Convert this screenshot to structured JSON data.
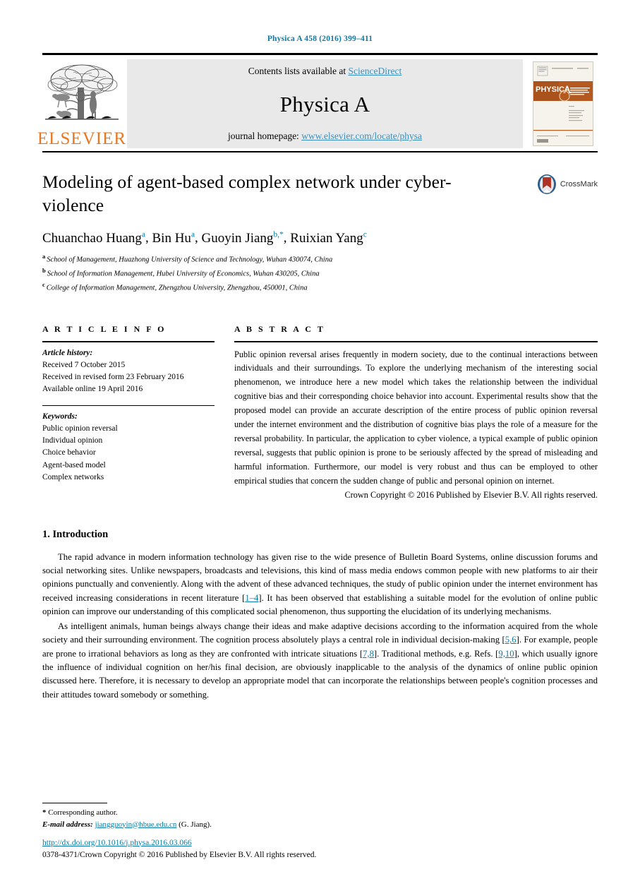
{
  "running_head": "Physica A 458 (2016) 399–411",
  "masthead": {
    "publisher_name": "ELSEVIER",
    "contents_prefix": "Contents lists available at ",
    "contents_link": "ScienceDirect",
    "journal_title": "Physica A",
    "homepage_prefix": "journal homepage: ",
    "homepage_link": "www.elsevier.com/locate/physa",
    "cover_title": "PHYSICA",
    "cover_letter": "A",
    "cover_subtitle": "STATISTICAL MECHANICS AND ITS APPLICATIONS"
  },
  "article": {
    "title": "Modeling of agent-based complex network under cyber-violence",
    "crossmark_label": "CrossMark",
    "authors": [
      {
        "name": "Chuanchao Huang",
        "marks": "a",
        "sep": ", "
      },
      {
        "name": "Bin Hu",
        "marks": "a",
        "sep": ", "
      },
      {
        "name": "Guoyin Jiang",
        "marks": "b,*",
        "sep": ", "
      },
      {
        "name": "Ruixian Yang",
        "marks": "c",
        "sep": ""
      }
    ],
    "affiliations": [
      {
        "mark": "a",
        "text": "School of Management, Huazhong University of Science and Technology, Wuhan 430074, China"
      },
      {
        "mark": "b",
        "text": "School of Information Management, Hubei University of Economics, Wuhan 430205, China"
      },
      {
        "mark": "c",
        "text": "College of Information Management, Zhengzhou University, Zhengzhou, 450001, China"
      }
    ]
  },
  "article_info": {
    "heading": "A R T I C L E   I N F O",
    "history_label": "Article history:",
    "history": [
      "Received 7 October 2015",
      "Received in revised form 23 February 2016",
      "Available online 19 April 2016"
    ],
    "keywords_label": "Keywords:",
    "keywords": [
      "Public opinion reversal",
      "Individual opinion",
      "Choice behavior",
      "Agent-based model",
      "Complex networks"
    ]
  },
  "abstract": {
    "heading": "A B S T R A C T",
    "text": "Public opinion reversal arises frequently in modern society, due to the continual interactions between individuals and their surroundings. To explore the underlying mechanism of the interesting social phenomenon, we introduce here a new model which takes the relationship between the individual cognitive bias and their corresponding choice behavior into account. Experimental results show that the proposed model can provide an accurate description of the entire process of public opinion reversal under the internet environment and the distribution of cognitive bias plays the role of a measure for the reversal probability. In particular, the application to cyber violence, a typical example of public opinion reversal, suggests that public opinion is prone to be seriously affected by the spread of misleading and harmful information. Furthermore, our model is very robust and thus can be employed to other empirical studies that concern the sudden change of public and personal opinion on internet.",
    "copyright": "Crown Copyright © 2016 Published by Elsevier B.V. All rights reserved."
  },
  "introduction": {
    "section_number": "1.",
    "section_title": "Introduction",
    "paragraph1_part1": "The rapid advance in modern information technology has given rise to the wide presence of Bulletin Board Systems, online discussion forums and social networking sites. Unlike newspapers, broadcasts and televisions, this kind of mass media endows common people with new platforms to air their opinions punctually and conveniently. Along with the advent of these advanced techniques, the study of public opinion under the internet environment has received increasing considerations in recent literature [",
    "paragraph1_ref1": "1–4",
    "paragraph1_part2": "]. It has been observed that establishing a suitable model for the evolution of online public opinion can improve our understanding of this complicated social phenomenon, thus supporting the elucidation of its underlying mechanisms.",
    "paragraph2_part1": "As intelligent animals, human beings always change their ideas and make adaptive decisions according to the information acquired from the whole society and their surrounding environment. The cognition process absolutely plays a central role in individual decision-making [",
    "paragraph2_ref1": "5,6",
    "paragraph2_part2": "]. For example, people are prone to irrational behaviors as long as they are confronted with intricate situations [",
    "paragraph2_ref2": "7,8",
    "paragraph2_part3": "]. Traditional methods, e.g. Refs. [",
    "paragraph2_ref3": "9,10",
    "paragraph2_part4": "], which usually ignore the influence of individual cognition on her/his final decision, are obviously inapplicable to the analysis of the dynamics of online public opinion discussed here. Therefore, it is necessary to develop an appropriate model that can incorporate the relationships between people's cognition processes and their attitudes toward somebody or something."
  },
  "footer": {
    "corresponding_star": "*",
    "corresponding_text": "Corresponding author.",
    "email_label": "E-mail address:",
    "email_address": "jiangguoyin@hbue.edu.cn",
    "email_suffix": "(G. Jiang).",
    "doi_url": "http://dx.doi.org/10.1016/j.physa.2016.03.066",
    "issn_line": "0378-4371/Crown Copyright © 2016 Published by Elsevier B.V. All rights reserved."
  },
  "colors": {
    "link": "#0b7aa5",
    "sciencedirect": "#3a8fbe",
    "elsevier_orange": "#E87722",
    "masthead_bg": "#e9e9e9"
  }
}
